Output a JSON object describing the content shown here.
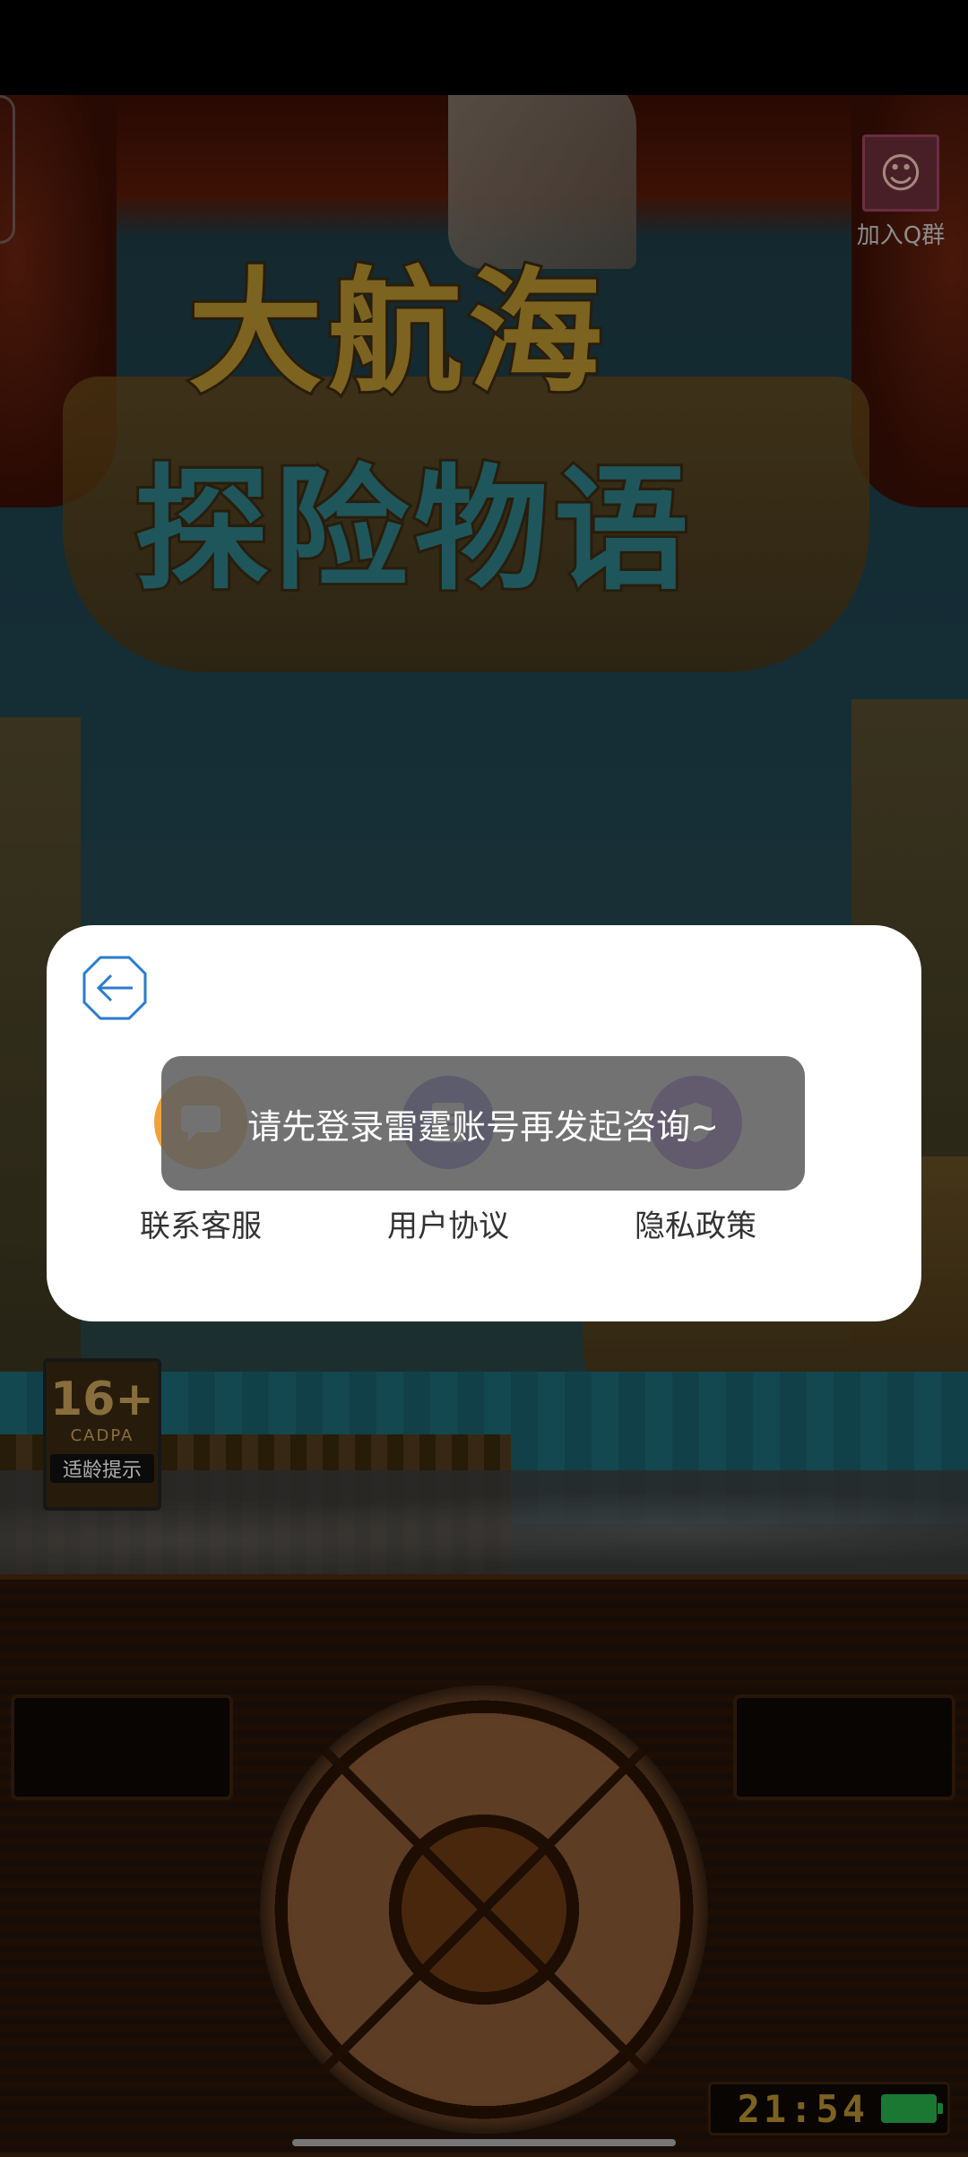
{
  "top_right": {
    "join_qq_label": "加入Q群"
  },
  "game_logo": {
    "line1": "大航海",
    "line2": "探险物语"
  },
  "age_rating": {
    "rating": "16+",
    "org": "CADPA",
    "hint": "适龄提示"
  },
  "dialog": {
    "actions": [
      {
        "label": "联系客服",
        "icon": "chat-icon",
        "color": "#f0a23a"
      },
      {
        "label": "用户协议",
        "icon": "document-icon",
        "color": "#4a49d4"
      },
      {
        "label": "隐私政策",
        "icon": "shield-icon",
        "color": "#7a3fd0"
      }
    ]
  },
  "toast": {
    "message": "请先登录雷霆账号再发起咨询~"
  },
  "device": {
    "time": "21:54"
  },
  "colors": {
    "accent_blue": "#2a7bd0",
    "toast_bg": "#5e5e5e"
  }
}
